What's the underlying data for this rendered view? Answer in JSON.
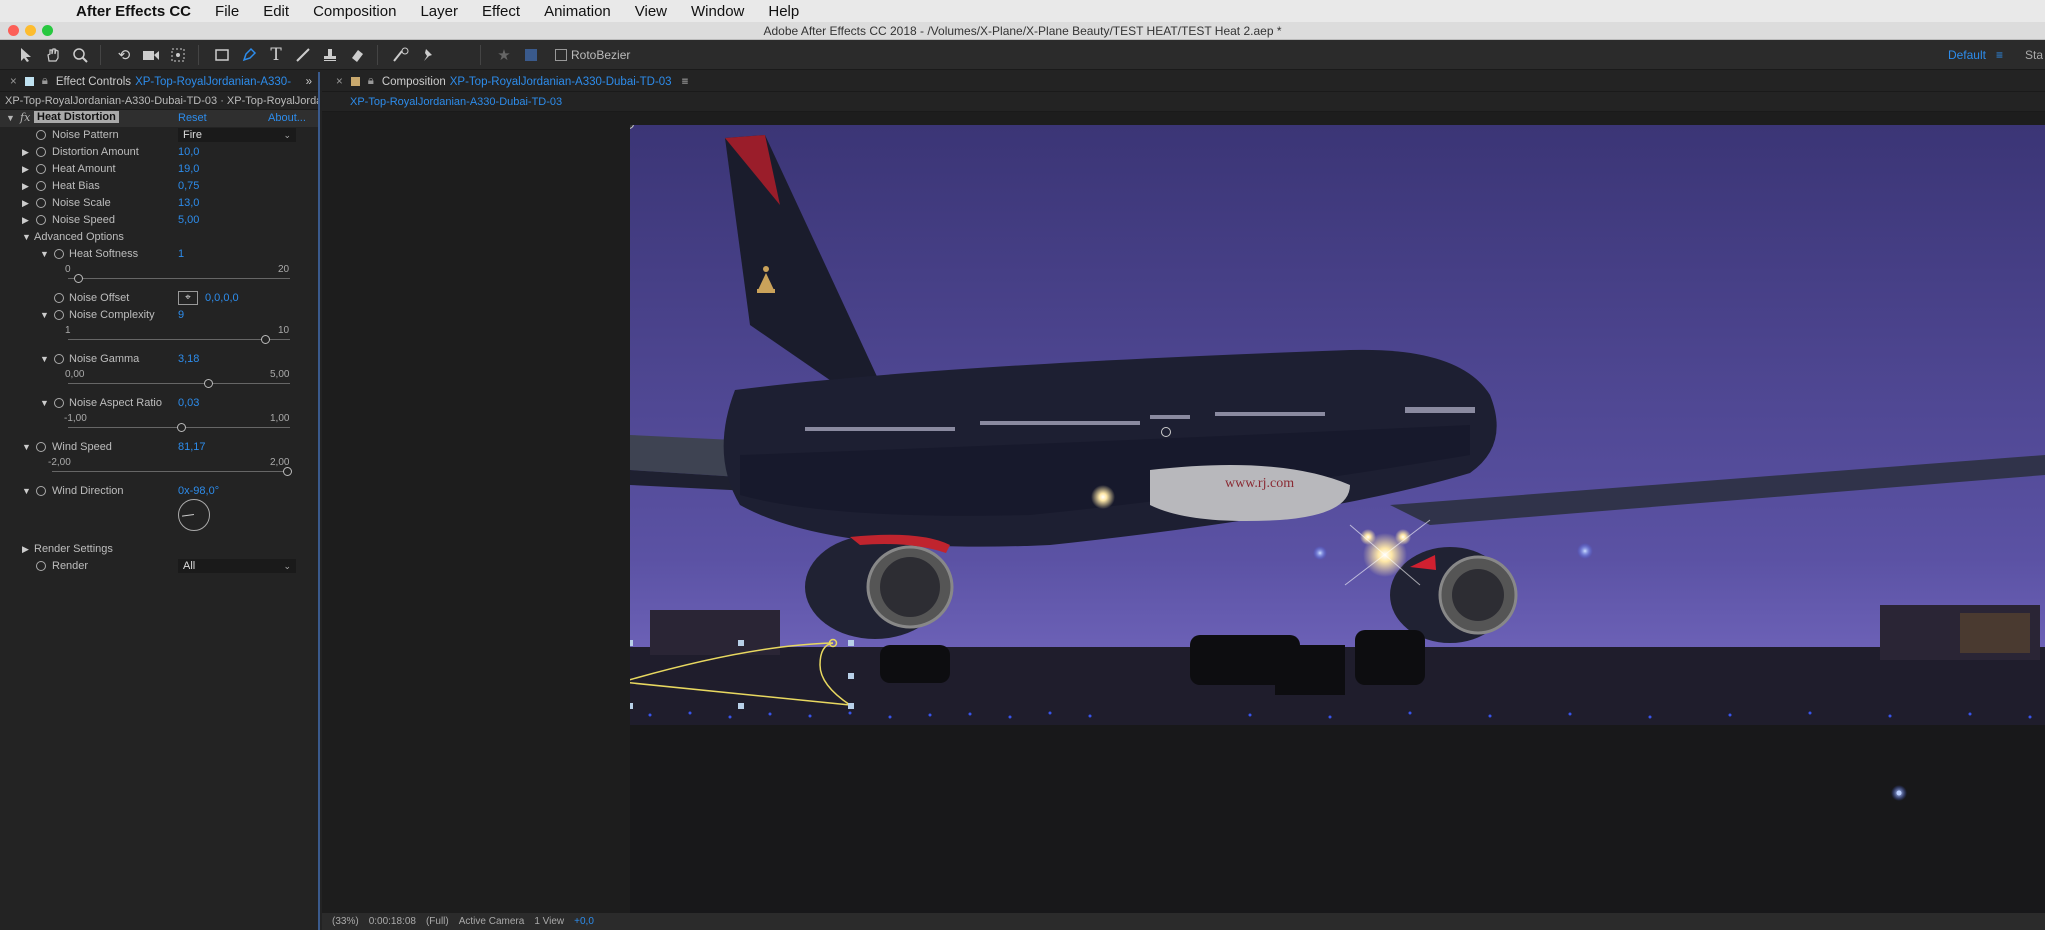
{
  "menubar": {
    "app": "After Effects CC",
    "items": [
      "File",
      "Edit",
      "Composition",
      "Layer",
      "Effect",
      "Animation",
      "View",
      "Window",
      "Help"
    ]
  },
  "window": {
    "title": "Adobe After Effects CC 2018 - /Volumes/X-Plane/X-Plane Beauty/TEST HEAT/TEST Heat 2.aep *"
  },
  "toolbar": {
    "tools": [
      "selection-icon",
      "hand-icon",
      "zoom-icon",
      "rotate-icon",
      "camera-icon",
      "pan-behind-icon",
      "rectangle-icon",
      "pen-icon",
      "type-icon",
      "brush-icon",
      "clone-stamp-icon",
      "eraser-icon",
      "roto-brush-icon",
      "puppet-pin-icon"
    ],
    "rotobezier_label": "RotoBezier",
    "workspace": "Default",
    "workspace_next": "Sta"
  },
  "effect_controls": {
    "tab_prefix": "Effect Controls",
    "tab_layer": "XP-Top-RoyalJordanian-A330-",
    "subtitle": "XP-Top-RoyalJordanian-A330-Dubai-TD-03 · XP-Top-RoyalJordani",
    "effect_name": "Heat Distortion",
    "reset": "Reset",
    "about": "About...",
    "noise_pattern": {
      "label": "Noise Pattern",
      "value": "Fire"
    },
    "props": [
      {
        "label": "Distortion Amount",
        "value": "10,0"
      },
      {
        "label": "Heat Amount",
        "value": "19,0"
      },
      {
        "label": "Heat Bias",
        "value": "0,75"
      },
      {
        "label": "Noise Scale",
        "value": "13,0"
      },
      {
        "label": "Noise Speed",
        "value": "5,00"
      }
    ],
    "advanced_label": "Advanced Options",
    "heat_softness": {
      "label": "Heat Softness",
      "value": "1",
      "min": "0",
      "max": "20",
      "fraction": 0.05
    },
    "noise_offset": {
      "label": "Noise Offset",
      "value": "0,0,0,0"
    },
    "noise_complexity": {
      "label": "Noise Complexity",
      "value": "9",
      "min": "1",
      "max": "10",
      "fraction": 0.89
    },
    "noise_gamma": {
      "label": "Noise Gamma",
      "value": "3,18",
      "min": "0,00",
      "max": "5,00",
      "fraction": 0.636
    },
    "noise_aspect": {
      "label": "Noise Aspect Ratio",
      "value": "0,03",
      "min": "-1,00",
      "max": "1,00",
      "fraction": 0.515
    },
    "wind_speed": {
      "label": "Wind Speed",
      "value": "81,17",
      "min": "-2,00",
      "max": "2,00",
      "fraction": 1.0
    },
    "wind_direction": {
      "label": "Wind Direction",
      "value": "0x-98,0°"
    },
    "render_settings": "Render Settings",
    "render": {
      "label": "Render",
      "value": "All"
    }
  },
  "composition": {
    "tab_prefix": "Composition",
    "tab_name": "XP-Top-RoyalJordanian-A330-Dubai-TD-03",
    "sub_tab": "XP-Top-RoyalJordanian-A330-Dubai-TD-03",
    "url_text": "www.rj.com",
    "bottom": [
      "(33%)",
      "0:00:18:08",
      "(Full)",
      "Active Camera",
      "1 View",
      "+0,0"
    ]
  },
  "colors": {
    "accent": "#2d8ceb",
    "sky_top": "#3a3575",
    "sky_bottom": "#6d63b8"
  }
}
